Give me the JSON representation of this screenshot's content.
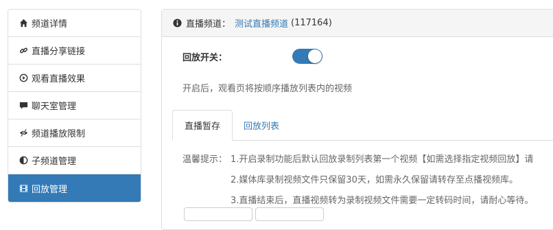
{
  "sidebar": {
    "items": [
      {
        "label": "频道详情",
        "icon": "home-icon",
        "active": false
      },
      {
        "label": "直播分享链接",
        "icon": "link-icon",
        "active": false
      },
      {
        "label": "观看直播效果",
        "icon": "play-circle-icon",
        "active": false
      },
      {
        "label": "聊天室管理",
        "icon": "comment-icon",
        "active": false
      },
      {
        "label": "频道播放限制",
        "icon": "eye-slash-icon",
        "active": false
      },
      {
        "label": "子频道管理",
        "icon": "adjust-icon",
        "active": false
      },
      {
        "label": "回放管理",
        "icon": "film-icon",
        "active": true
      }
    ]
  },
  "header": {
    "prefix": "直播频道：",
    "channel_name": "测试直播频道",
    "channel_id": "(117164)"
  },
  "playback_switch": {
    "label": "回放开关：",
    "on": true
  },
  "hint": "开启后，观看页将按顺序播放列表内的视频",
  "tabs": [
    {
      "label": "直播暂存",
      "active": true
    },
    {
      "label": "回放列表",
      "active": false
    }
  ],
  "tips": {
    "prefix": "温馨提示：",
    "lines": [
      "1.开启录制功能后默认回放录制列表第一个视频【如需选择指定视频回放】请",
      "2.媒体库录制视频文件只保留30天，如需永久保留请转存至点播视频库。",
      "3.直播结束后，直播视频转为录制视频文件需要一定转码时间，请耐心等待。"
    ]
  },
  "colors": {
    "primary": "#337ab7",
    "border": "#dddddd",
    "header_bg": "#f5f5f5"
  }
}
